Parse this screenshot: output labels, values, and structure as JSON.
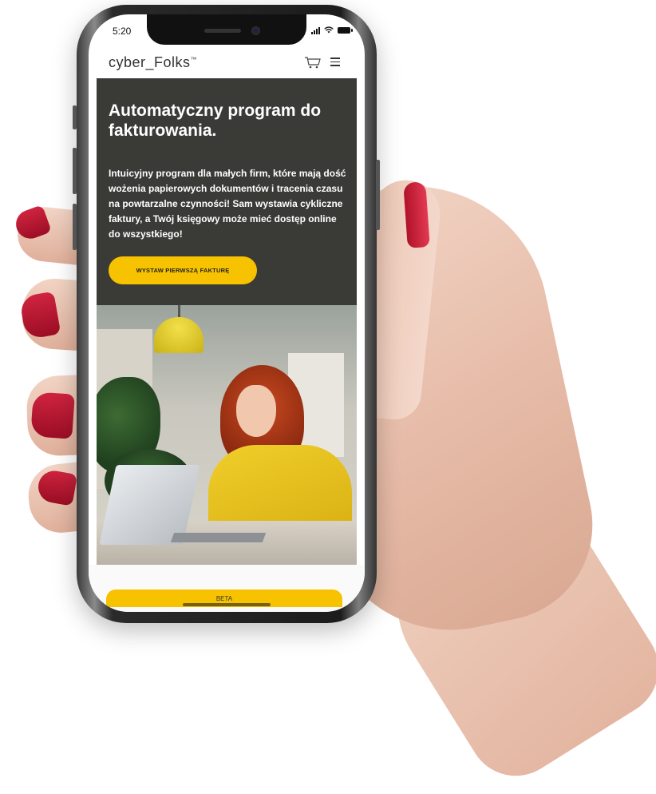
{
  "status_bar": {
    "time": "5:20"
  },
  "header": {
    "logo": "cyber_Folks",
    "logo_mark": "™"
  },
  "hero": {
    "title": "Automatyczny program do fakturowania.",
    "description": "Intuicyjny program dla małych firm, które mają dość wożenia papierowych dokumentów i tracenia czasu na powtarzalne czynności! Sam wystawia cykliczne faktury, a Twój księgowy może mieć dostęp online do wszystkiego!",
    "cta_label": "WYSTAW PIERWSZĄ FAKTURĘ"
  },
  "beta_label": "BETA",
  "icons": {
    "cart": "cart-icon",
    "menu": "hamburger-menu-icon",
    "signal": "signal-icon",
    "wifi": "wifi-icon",
    "battery": "battery-icon"
  },
  "colors": {
    "accent": "#f7c300",
    "hero_background": "#3a3a37",
    "nail_polish": "#c81d38"
  }
}
